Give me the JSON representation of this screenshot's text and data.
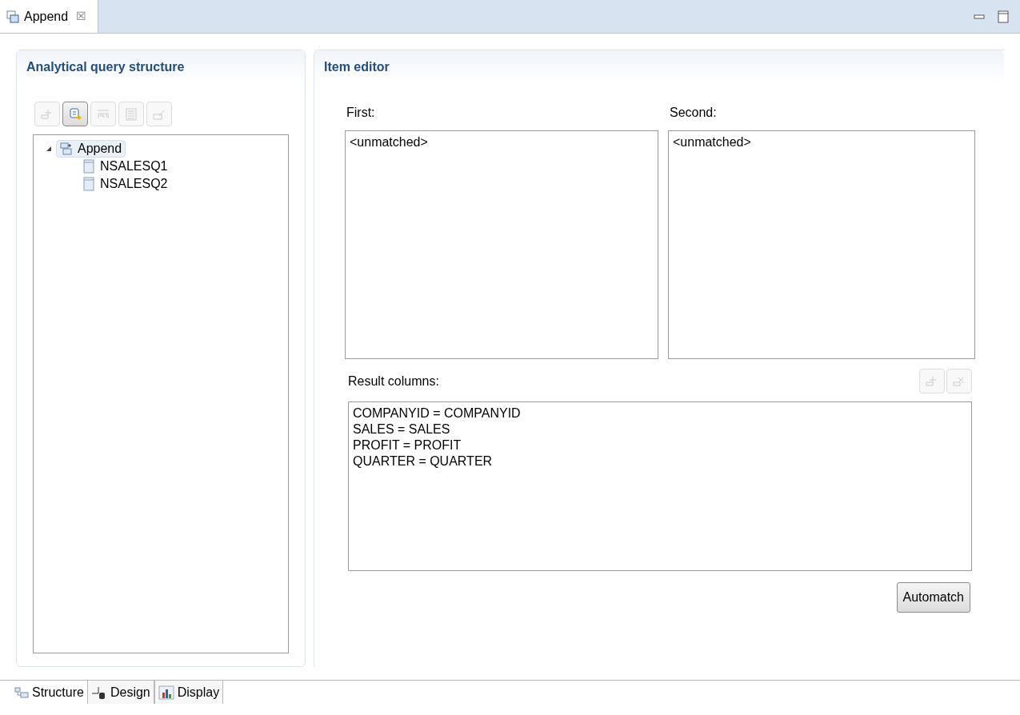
{
  "editor_tab": {
    "title": "Append",
    "close": "☒"
  },
  "structure_panel": {
    "title": "Analytical query structure",
    "toolbar": [
      {
        "kind": "add",
        "disabled": true
      },
      {
        "kind": "expression",
        "disabled": false
      },
      {
        "kind": "rename",
        "disabled": true
      },
      {
        "kind": "properties",
        "disabled": true
      },
      {
        "kind": "edit",
        "disabled": true
      }
    ],
    "tree": [
      {
        "label": "Append",
        "kind": "append",
        "expanded": true,
        "selected": true,
        "children": [
          {
            "label": "NSALESQ1",
            "kind": "table",
            "selected": false
          },
          {
            "label": "NSALESQ2",
            "kind": "table",
            "selected": false
          }
        ]
      }
    ]
  },
  "item_editor": {
    "title": "Item editor",
    "first": {
      "label": "First:",
      "items": [
        "<unmatched>"
      ]
    },
    "second": {
      "label": "Second:",
      "items": [
        "<unmatched>"
      ]
    },
    "result_columns": {
      "label": "Result columns:",
      "actions": [
        {
          "kind": "add",
          "disabled": true
        },
        {
          "kind": "remove",
          "disabled": true
        }
      ],
      "items": [
        "COMPANYID = COMPANYID",
        "SALES = SALES",
        "PROFIT = PROFIT",
        "QUARTER = QUARTER"
      ]
    },
    "automatch_button": "Automatch"
  },
  "bottom_tabs": [
    {
      "label": "Structure",
      "kind": "structure",
      "selected": true
    },
    {
      "label": "Design",
      "kind": "design",
      "selected": false
    },
    {
      "label": "Display",
      "kind": "display",
      "selected": false
    }
  ]
}
